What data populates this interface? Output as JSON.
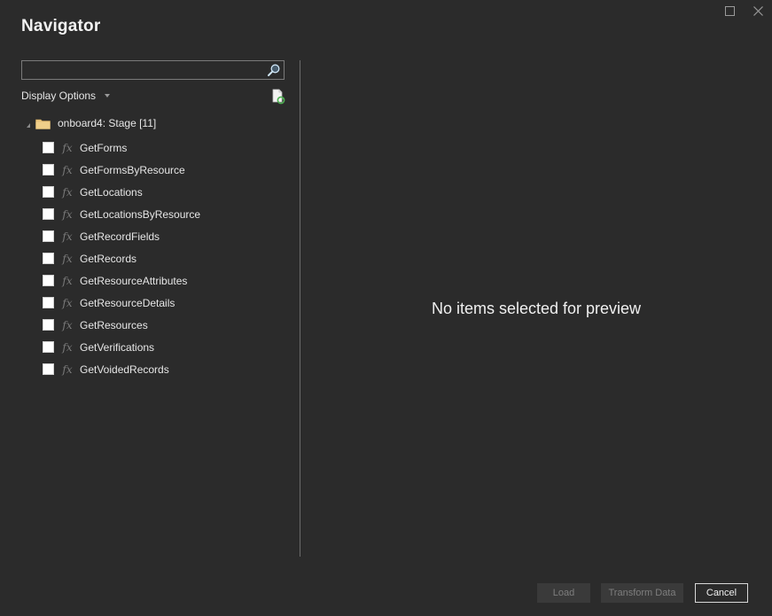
{
  "window": {
    "title": "Navigator",
    "controls": [
      "maximize-icon",
      "close-icon"
    ]
  },
  "search": {
    "value": "",
    "placeholder": "",
    "icon": "search-icon"
  },
  "display_options": {
    "label": "Display Options",
    "icon": "chevron-down-icon"
  },
  "refresh": {
    "icon": "refresh-icon"
  },
  "tree": {
    "root": {
      "label": "onboard4: Stage [11]",
      "icon": "folder-icon",
      "expanded": true
    },
    "items": [
      {
        "label": "GetForms",
        "checked": false,
        "icon": "function-icon"
      },
      {
        "label": "GetFormsByResource",
        "checked": false,
        "icon": "function-icon"
      },
      {
        "label": "GetLocations",
        "checked": false,
        "icon": "function-icon"
      },
      {
        "label": "GetLocationsByResource",
        "checked": false,
        "icon": "function-icon"
      },
      {
        "label": "GetRecordFields",
        "checked": false,
        "icon": "function-icon"
      },
      {
        "label": "GetRecords",
        "checked": false,
        "icon": "function-icon"
      },
      {
        "label": "GetResourceAttributes",
        "checked": false,
        "icon": "function-icon"
      },
      {
        "label": "GetResourceDetails",
        "checked": false,
        "icon": "function-icon"
      },
      {
        "label": "GetResources",
        "checked": false,
        "icon": "function-icon"
      },
      {
        "label": "GetVerifications",
        "checked": false,
        "icon": "function-icon"
      },
      {
        "label": "GetVoidedRecords",
        "checked": false,
        "icon": "function-icon"
      }
    ],
    "fx_glyph": "fx"
  },
  "preview": {
    "message": "No items selected for preview"
  },
  "footer": {
    "load_label": "Load",
    "transform_label": "Transform Data",
    "cancel_label": "Cancel"
  },
  "colors": {
    "background": "#2b2b2b",
    "text": "#e6e6e6",
    "folder": "#e8c27a",
    "search_icon": "#7fb8e6",
    "refresh_arrow": "#4caf50"
  }
}
